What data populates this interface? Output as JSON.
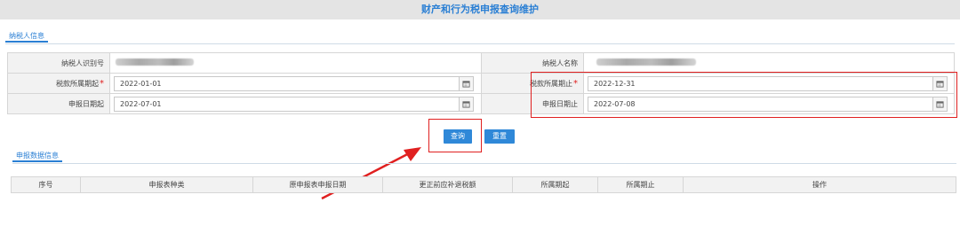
{
  "page": {
    "title": "财产和行为税申报查询维护"
  },
  "taxpayer_section": {
    "tab_label": "纳税人信息"
  },
  "form": {
    "taxpayer_id_label": "纳税人识别号",
    "taxpayer_name_label": "纳税人名称",
    "period_start_label": "税款所属期起",
    "period_end_label": "税款所属期止",
    "period_start_value": "2022-01-01",
    "period_end_value": "2022-12-31",
    "declare_start_label": "申报日期起",
    "declare_end_label": "申报日期止",
    "declare_start_value": "2022-07-01",
    "declare_end_value": "2022-07-08",
    "required_mark": "*"
  },
  "buttons": {
    "query_label": "查询",
    "reset_label": "重置"
  },
  "data_section": {
    "tab_label": "申报数据信息"
  },
  "grid": {
    "columns": [
      "序号",
      "申报表种类",
      "原申报表申报日期",
      "更正前应补退税额",
      "所属期起",
      "所属期止",
      "操作"
    ]
  },
  "colors": {
    "accent": "#2f88d8",
    "highlight": "#e02020",
    "header_bg": "#e4e4e4"
  },
  "icons": {
    "calendar": "calendar-icon"
  }
}
